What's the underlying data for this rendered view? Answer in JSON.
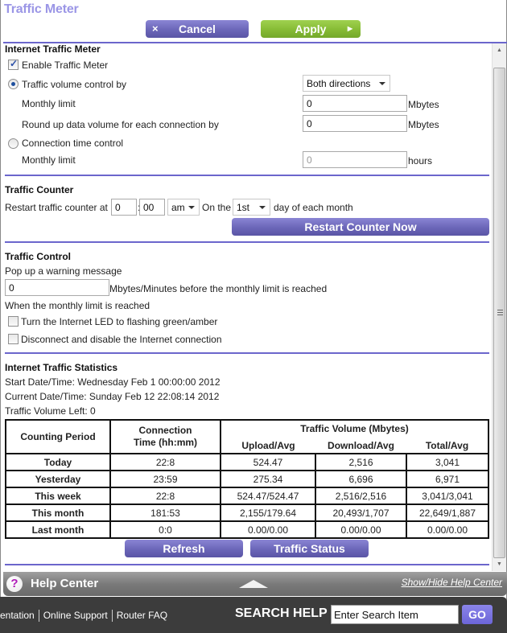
{
  "page": {
    "title": "Traffic Meter"
  },
  "toolbar": {
    "cancel_icon": "×",
    "cancel_label": "Cancel",
    "apply_label": "Apply",
    "apply_icon": "▶"
  },
  "internet_traffic_meter": {
    "heading": "Internet Traffic Meter",
    "enable_label": "Enable Traffic Meter",
    "enable_checked": true,
    "volume_control_label": "Traffic volume control by",
    "volume_control_selected": true,
    "direction_selected": "Both directions",
    "monthly_limit_label": "Monthly limit",
    "monthly_limit_value": "0",
    "monthly_limit_unit": "Mbytes",
    "round_up_label": "Round up data volume for each connection by",
    "round_up_value": "0",
    "round_up_unit": "Mbytes",
    "time_control_label": "Connection time control",
    "time_control_selected": false,
    "time_monthly_limit_label": "Monthly limit",
    "time_monthly_limit_value": "0",
    "time_monthly_limit_unit": "hours"
  },
  "traffic_counter": {
    "heading": "Traffic Counter",
    "restart_label": "Restart traffic counter at",
    "hour_value": "0",
    "colon": ":",
    "minute_value": "00",
    "ampm_selected": "am",
    "on_the_label": "On the",
    "day_selected": "1st",
    "day_suffix_label": "day of each month",
    "restart_now_label": "Restart Counter Now"
  },
  "traffic_control": {
    "heading": "Traffic Control",
    "popup_label": "Pop up a warning message",
    "warning_value": "0",
    "warning_suffix": "Mbytes/Minutes before the monthly limit is reached",
    "when_reached_label": "When the monthly limit is reached",
    "led_label": "Turn the Internet LED to flashing green/amber",
    "led_checked": false,
    "disconnect_label": "Disconnect and disable the Internet connection",
    "disconnect_checked": false
  },
  "statistics": {
    "heading": "Internet Traffic Statistics",
    "start_label": "Start Date/Time: Wednesday Feb 1 00:00:00 2012",
    "current_label": "Current Date/Time: Sunday Feb 12 22:08:14 2012",
    "volume_left_label": "Traffic Volume Left: 0",
    "table": {
      "headers": {
        "period": "Counting Period",
        "connection_time": "Connection Time (hh:mm)",
        "traffic_volume": "Traffic Volume (Mbytes)",
        "upload": "Upload/Avg",
        "download": "Download/Avg",
        "total": "Total/Avg"
      },
      "rows": [
        {
          "period": "Today",
          "time": "22:8",
          "upload": "524.47",
          "download": "2,516",
          "total": "3,041"
        },
        {
          "period": "Yesterday",
          "time": "23:59",
          "upload": "275.34",
          "download": "6,696",
          "total": "6,971"
        },
        {
          "period": "This week",
          "time": "22:8",
          "upload": "524.47/524.47",
          "download": "2,516/2,516",
          "total": "3,041/3,041"
        },
        {
          "period": "This month",
          "time": "181:53",
          "upload": "2,155/179.64",
          "download": "20,493/1,707",
          "total": "22,649/1,887"
        },
        {
          "period": "Last month",
          "time": "0:0",
          "upload": "0.00/0.00",
          "download": "0.00/0.00",
          "total": "0.00/0.00"
        }
      ]
    },
    "refresh_label": "Refresh",
    "traffic_status_label": "Traffic Status"
  },
  "help": {
    "icon": "?",
    "title": "Help Center",
    "toggle_label": "Show/Hide Help Center"
  },
  "footer": {
    "links": [
      "entation",
      "Online Support",
      "Router FAQ"
    ],
    "search_label": "SEARCH HELP",
    "search_placeholder": "Enter Search Item",
    "go_label": "GO"
  },
  "colors": {
    "accent_purple": "#6b66cc",
    "title_purple": "#9b96e6",
    "apply_green": "#86bb35"
  }
}
